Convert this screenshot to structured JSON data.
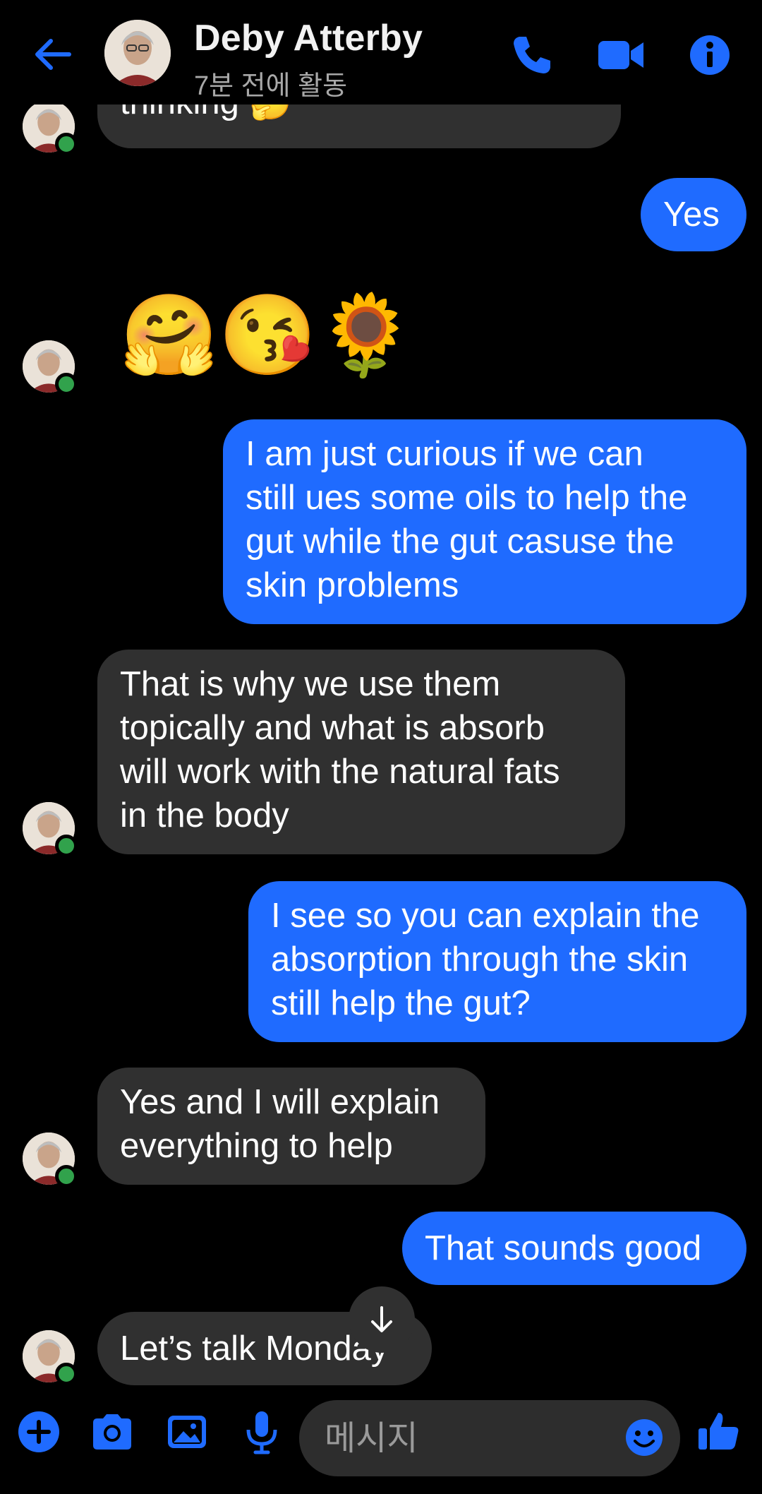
{
  "header": {
    "contact_name": "Deby Atterby",
    "status": "7분 전에 활동"
  },
  "messages": [
    {
      "side": "in",
      "text": "thinking 🤔"
    },
    {
      "side": "out",
      "text": "Yes"
    },
    {
      "side": "in",
      "text": "🤗😘🌻"
    },
    {
      "side": "out",
      "text": "I am just curious if we can\nstill ues some oils to help the\ngut while the gut casuse the\nskin problems"
    },
    {
      "side": "in",
      "text": "That is why we use them\ntopically and what is absorb\nwill work with the natural fats\nin the body"
    },
    {
      "side": "out",
      "text": "I see so you can explain the\nabsorption through the skin\nstill help the gut?"
    },
    {
      "side": "in",
      "text": "Yes and I will explain\neverything to help"
    },
    {
      "side": "out",
      "text": "That sounds good"
    },
    {
      "side": "in",
      "text": "Let’s talk Monday"
    }
  ],
  "composer": {
    "placeholder": "메시지"
  },
  "colors": {
    "accent": "#1f6bff",
    "incoming_bubble": "#303030",
    "online": "#31a24c",
    "background": "#000000"
  },
  "icons": [
    "back-arrow-icon",
    "phone-icon",
    "video-camera-icon",
    "info-icon",
    "scroll-down-arrow-icon",
    "plus-icon",
    "camera-icon",
    "gallery-icon",
    "microphone-icon",
    "emoji-icon",
    "thumbs-up-icon"
  ]
}
